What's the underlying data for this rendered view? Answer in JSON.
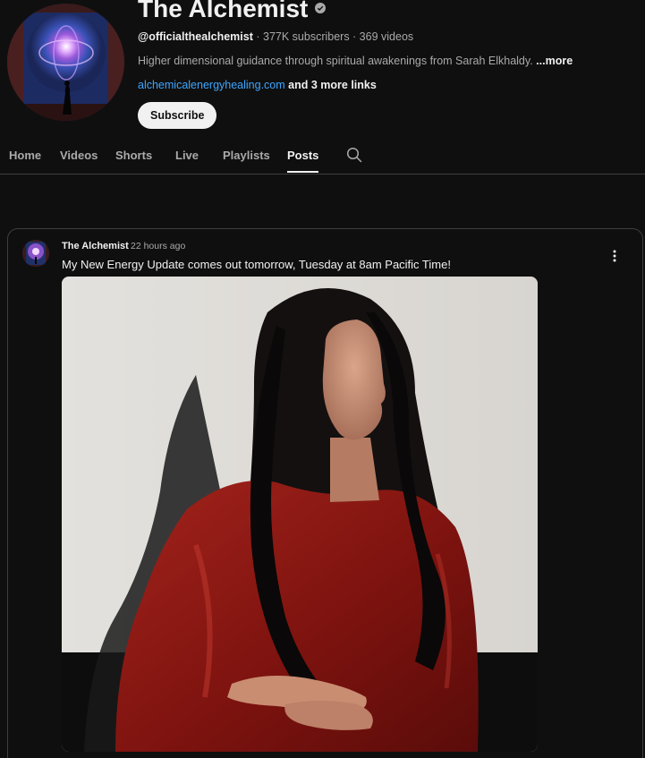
{
  "channel": {
    "name": "The Alchemist",
    "handle": "@officialthealchemist",
    "stats": " · 377K subscribers · 369 videos",
    "description": "Higher dimensional guidance through spiritual awakenings from Sarah Elkhaldy. ",
    "more_label": "...more",
    "link": "alchemicalenergyhealing.com",
    "more_links": " and 3 more links",
    "subscribe_label": "Subscribe"
  },
  "tabs": [
    {
      "label": "Home"
    },
    {
      "label": "Videos"
    },
    {
      "label": "Shorts"
    },
    {
      "label": "Live"
    },
    {
      "label": "Playlists"
    },
    {
      "label": "Posts",
      "active": true
    }
  ],
  "post": {
    "author": "The Alchemist",
    "time": "22 hours ago",
    "text": "My New Energy Update comes out tomorrow, Tuesday at 8am Pacific Time!"
  },
  "icons": {
    "verified": "verified-check-icon",
    "search": "search-icon",
    "menu": "more-vertical-icon"
  },
  "colors": {
    "background": "#0f0f0f",
    "link": "#3ea6ff",
    "text_primary": "#f1f1f1",
    "text_secondary": "#aaaaaa"
  }
}
